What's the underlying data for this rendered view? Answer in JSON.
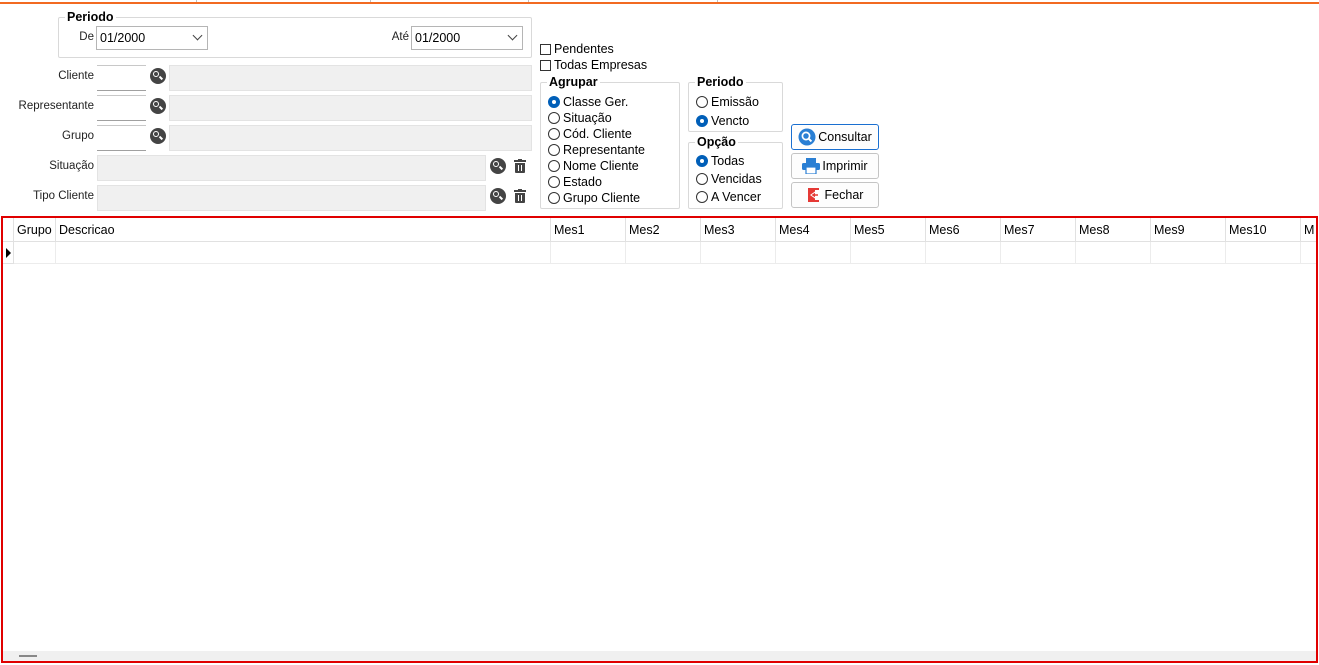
{
  "filters": {
    "periodo_group": {
      "legend": "Periodo",
      "de_label": "De",
      "de_value": "01/2000",
      "ate_label": "Até",
      "ate_value": "01/2000"
    },
    "cliente_label": "Cliente",
    "representante_label": "Representante",
    "grupo_label": "Grupo",
    "situacao_label": "Situação",
    "tipo_cliente_label": "Tipo Cliente"
  },
  "checkboxes": {
    "pendentes": {
      "label": "Pendentes",
      "checked": false
    },
    "todas_empresas": {
      "label": "Todas Empresas",
      "checked": false
    }
  },
  "agrupar": {
    "legend": "Agrupar",
    "options": [
      {
        "label": "Classe Ger.",
        "selected": true
      },
      {
        "label": "Situação",
        "selected": false
      },
      {
        "label": "Cód. Cliente",
        "selected": false
      },
      {
        "label": "Representante",
        "selected": false
      },
      {
        "label": "Nome Cliente",
        "selected": false
      },
      {
        "label": "Estado",
        "selected": false
      },
      {
        "label": "Grupo Cliente",
        "selected": false
      }
    ]
  },
  "periodo_tipo": {
    "legend": "Periodo",
    "options": [
      {
        "label": "Emissão",
        "selected": false
      },
      {
        "label": "Vencto",
        "selected": true
      }
    ]
  },
  "opcao": {
    "legend": "Opção",
    "options": [
      {
        "label": "Todas",
        "selected": true
      },
      {
        "label": "Vencidas",
        "selected": false
      },
      {
        "label": "A Vencer",
        "selected": false
      }
    ]
  },
  "buttons": {
    "consultar": "Consultar",
    "imprimir": "Imprimir",
    "fechar": "Fechar"
  },
  "grid": {
    "columns": [
      "Grupo",
      "Descricao",
      "Mes1",
      "Mes2",
      "Mes3",
      "Mes4",
      "Mes5",
      "Mes6",
      "Mes7",
      "Mes8",
      "Mes9",
      "Mes10",
      "M"
    ]
  },
  "colors": {
    "accent_orange": "#f26a21",
    "grid_border_red": "#e00000",
    "radio_selected_blue": "#005fb8"
  }
}
